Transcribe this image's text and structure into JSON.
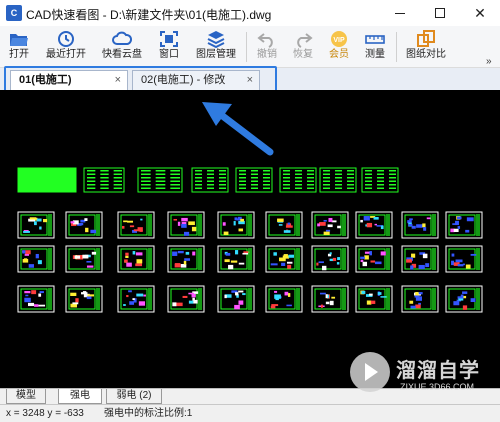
{
  "window": {
    "title": "CAD快速看图 - D:\\新建文件夹\\01(电施工).dwg",
    "icon": "cad-app-icon"
  },
  "toolbar": {
    "items": [
      {
        "label": "打开",
        "icon": "folder-open-icon",
        "enabled": true
      },
      {
        "label": "最近打开",
        "icon": "recent-clock-icon",
        "enabled": true
      },
      {
        "label": "快看云盘",
        "icon": "cloud-icon",
        "enabled": true
      },
      {
        "label": "窗口",
        "icon": "window-fit-icon",
        "enabled": true
      },
      {
        "label": "图层管理",
        "icon": "layers-icon",
        "enabled": true
      },
      {
        "label": "撤销",
        "icon": "undo-icon",
        "enabled": false
      },
      {
        "label": "恢复",
        "icon": "redo-icon",
        "enabled": false
      },
      {
        "label": "会员",
        "icon": "vip-badge-icon",
        "enabled": true
      },
      {
        "label": "测量",
        "icon": "ruler-icon",
        "enabled": true
      },
      {
        "label": "图纸对比",
        "icon": "compare-icon",
        "enabled": true
      }
    ],
    "more": "»"
  },
  "tabs": [
    {
      "label": "01(电施工)",
      "close": "×",
      "active": true
    },
    {
      "label": "02(电施工) - 修改",
      "close": "×",
      "active": false
    }
  ],
  "annotation": {
    "color": "#2f7be0"
  },
  "drawing": {
    "background": "#000000",
    "sheet_color": "#22ff22",
    "accent_colors": [
      "#ff3b3b",
      "#33ddff",
      "#ffee33",
      "#ff55ff",
      "#ffffff",
      "#3355ff"
    ]
  },
  "layout_tabs": [
    {
      "label": "模型",
      "active": false
    },
    {
      "label": "强电",
      "active": true
    },
    {
      "label": "弱电 (2)",
      "active": false
    }
  ],
  "status": {
    "coords": "x = 3248  y = -633",
    "message": "强电中的标注比例:1"
  },
  "watermark": {
    "text": "溜溜自学",
    "url": "ZIXUE.3D66.COM"
  }
}
